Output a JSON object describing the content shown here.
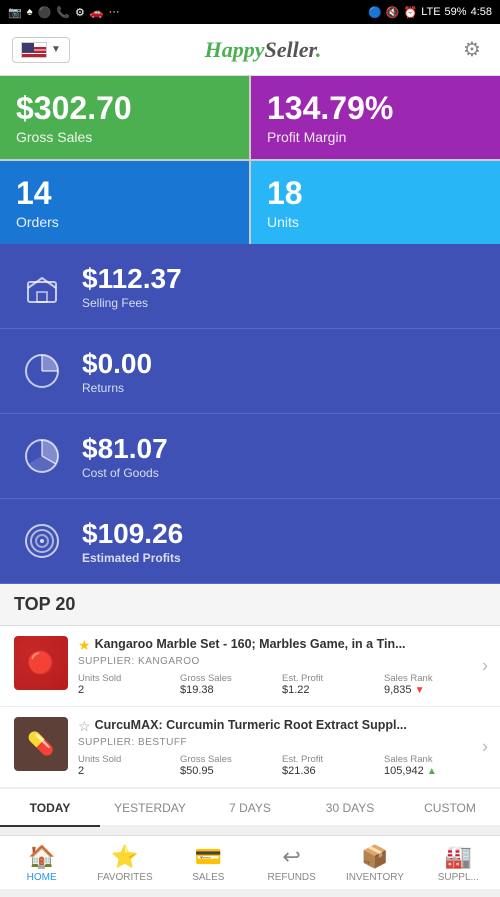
{
  "statusBar": {
    "leftIcons": [
      "📷",
      "♠",
      "🔵",
      "📞",
      "⚙",
      "🚗",
      "···"
    ],
    "rightIcons": [
      "🔵",
      "🔇",
      "⏰",
      "LTE",
      "59%",
      "4:58"
    ]
  },
  "topNav": {
    "logoText": "HappySeller",
    "logoColoredPart": "Happy",
    "settingsLabel": "settings"
  },
  "metrics": [
    {
      "id": "gross-sales",
      "value": "$302.70",
      "label": "Gross Sales",
      "color": "green"
    },
    {
      "id": "profit-margin",
      "value": "134.79%",
      "label": "Profit Margin",
      "color": "purple"
    },
    {
      "id": "orders",
      "value": "14",
      "label": "Orders",
      "color": "blue-dark"
    },
    {
      "id": "units",
      "value": "18",
      "label": "Units",
      "color": "blue-light"
    }
  ],
  "stats": [
    {
      "id": "selling-fees",
      "value": "$112.37",
      "label": "Selling Fees",
      "iconType": "box"
    },
    {
      "id": "returns",
      "value": "$0.00",
      "label": "Returns",
      "iconType": "pie"
    },
    {
      "id": "cost-of-goods",
      "value": "$81.07",
      "label": "Cost of Goods",
      "iconType": "pie"
    },
    {
      "id": "estimated-profits",
      "value": "$109.26",
      "label": "Estimated Profits",
      "iconType": "target",
      "bold": true
    }
  ],
  "top20": {
    "header": "TOP 20",
    "products": [
      {
        "id": "kangaroo-marbles",
        "starred": true,
        "title": "Kangaroo Marble Set - 160; Marbles Game, in a Tin...",
        "supplier": "SUPPLIER: KANGAROO",
        "unitsSoldLabel": "Units Sold",
        "unitsSold": "2",
        "grossSalesLabel": "Gross Sales",
        "grossSales": "$19.38",
        "estProfitLabel": "Est. Profit",
        "estProfit": "$1.22",
        "salesRankLabel": "Sales Rank",
        "salesRank": "9,835",
        "rankTrend": "▼",
        "rankTrendClass": "rank-down",
        "thumb": "🔴"
      },
      {
        "id": "curcumax",
        "starred": false,
        "title": "CurcuMAX: Curcumin Turmeric Root Extract Suppl...",
        "supplier": "SUPPLIER: BESTUFF",
        "unitsSoldLabel": "Units Sold",
        "unitsSold": "2",
        "grossSalesLabel": "Gross Sales",
        "grossSales": "$50.95",
        "estProfitLabel": "Est. Profit",
        "estProfit": "$21.36",
        "salesRankLabel": "Sales Rank",
        "salesRank": "105,942",
        "rankTrend": "▲",
        "rankTrendClass": "rank-up",
        "thumb": "💊"
      }
    ]
  },
  "dateTabs": [
    {
      "id": "today",
      "label": "TODAY",
      "active": true
    },
    {
      "id": "yesterday",
      "label": "YESTERDAY",
      "active": false
    },
    {
      "id": "7days",
      "label": "7 DAYS",
      "active": false
    },
    {
      "id": "30days",
      "label": "30 DAYS",
      "active": false
    },
    {
      "id": "custom",
      "label": "CUSTOM",
      "active": false
    }
  ],
  "bottomNav": [
    {
      "id": "home",
      "label": "HOME",
      "icon": "🏠",
      "active": true
    },
    {
      "id": "favorites",
      "label": "FAVORITES",
      "icon": "⭐",
      "active": false
    },
    {
      "id": "sales",
      "label": "SALES",
      "icon": "💳",
      "active": false
    },
    {
      "id": "refunds",
      "label": "REFUNDS",
      "icon": "↩",
      "active": false
    },
    {
      "id": "inventory",
      "label": "INVENTORY",
      "icon": "📦",
      "active": false
    },
    {
      "id": "supply",
      "label": "SUPPL...",
      "icon": "🏭",
      "active": false
    }
  ]
}
